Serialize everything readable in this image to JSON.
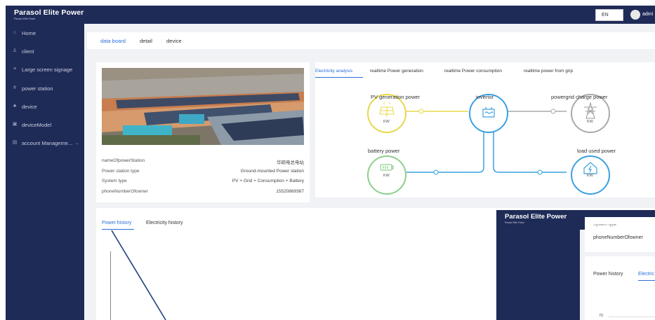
{
  "header": {
    "brand_title": "Parasol Elite Power",
    "brand_subtitle": "Parasol Elite Power",
    "language": "EN",
    "user": "admi"
  },
  "sidebar": {
    "items": [
      {
        "label": "Home",
        "icon": "home-icon"
      },
      {
        "label": "client",
        "icon": "user-icon"
      },
      {
        "label": "Large screen signage",
        "icon": "list-icon"
      },
      {
        "label": "power station",
        "icon": "grid-icon"
      },
      {
        "label": "device",
        "icon": "device-icon"
      },
      {
        "label": "deviceModel",
        "icon": "model-icon"
      },
      {
        "label": "account Manageme...",
        "icon": "account-icon"
      }
    ]
  },
  "tabs": [
    "data board",
    "detail",
    "device"
  ],
  "station": {
    "rows": [
      {
        "label": "nameOfpowerStation",
        "value": "华硕电总电站"
      },
      {
        "label": "Power station type",
        "value": "Ground-mounted Power station"
      },
      {
        "label": "System type",
        "value": "PV + Grid + Consumption + Battery"
      },
      {
        "label": "phoneNumberOfowner",
        "value": "15520869367"
      }
    ]
  },
  "energy": {
    "tabs": [
      "Electricity analysis",
      "realtime Power generation",
      "realtime Power consumption",
      "realtime power from grip"
    ],
    "nodes": {
      "pv": {
        "label": "PV generation power",
        "unit": "KW"
      },
      "inverter": {
        "label": "invertor"
      },
      "grid": {
        "label": "powergrid charge power",
        "unit": "KW"
      },
      "battery": {
        "label": "battery power",
        "unit": "KW"
      },
      "load": {
        "label": "load used power",
        "unit": "KW"
      }
    }
  },
  "history": {
    "tabs": [
      "Power history",
      "Electricity history"
    ]
  },
  "overlay": {
    "brand_title": "Parasol Elite Power",
    "brand_subtitle": "Parasol Elite Power",
    "field_partial": "System type",
    "field": "phoneNumberOfowner",
    "tabs": [
      "Power history",
      "Electric"
    ],
    "axis_tick": "70"
  },
  "colors": {
    "nav_bg": "#1f2b57",
    "accent": "#2b6fd6",
    "pv": "#e8d84a",
    "flow": "#3aa0e0",
    "grid": "#aaaaaa",
    "battery": "#8ccf8c",
    "annotation": "#1f3f7a"
  }
}
